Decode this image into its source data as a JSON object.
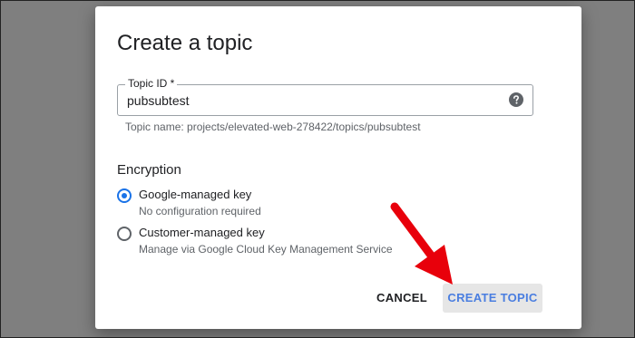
{
  "dialog": {
    "title": "Create a topic",
    "topic_field": {
      "label": "Topic ID *",
      "value": "pubsubtest",
      "hint": "Topic name: projects/elevated-web-278422/topics/pubsubtest",
      "help_icon": "help-circle-icon"
    },
    "encryption": {
      "heading": "Encryption",
      "options": [
        {
          "label": "Google-managed key",
          "description": "No configuration required",
          "selected": true
        },
        {
          "label": "Customer-managed key",
          "description": "Manage via Google Cloud Key Management Service",
          "selected": false
        }
      ]
    },
    "actions": {
      "cancel_label": "CANCEL",
      "create_label": "CREATE TOPIC"
    }
  },
  "colors": {
    "accent": "#1a73e8",
    "annotation_arrow": "#e8000b",
    "backdrop": "#7f7f7f"
  }
}
